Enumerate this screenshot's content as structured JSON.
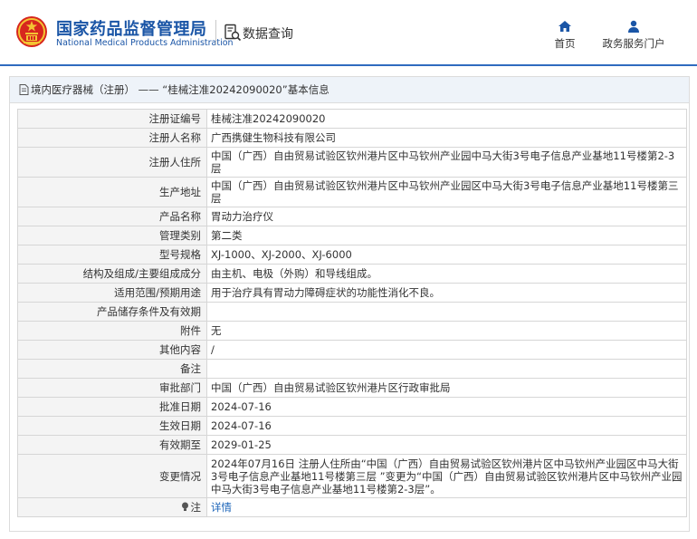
{
  "header": {
    "title_cn": "国家药品监督管理局",
    "title_en": "National Medical Products Administration",
    "query_label": "数据查询",
    "nav": [
      {
        "label": "首页",
        "icon": "home-icon"
      },
      {
        "label": "政务服务门户",
        "icon": "user-icon"
      }
    ]
  },
  "breadcrumb": {
    "text": "境内医疗器械（注册） —— “桂械注准20242090020”基本信息"
  },
  "rows": [
    {
      "label": "注册证编号",
      "value": "桂械注准20242090020"
    },
    {
      "label": "注册人名称",
      "value": "广西携健生物科技有限公司"
    },
    {
      "label": "注册人住所",
      "value": "中国（广西）自由贸易试验区钦州港片区中马钦州产业园中马大街3号电子信息产业基地11号楼第2-3层"
    },
    {
      "label": "生产地址",
      "value": "中国（广西）自由贸易试验区钦州港片区中马钦州产业园区中马大街3号电子信息产业基地11号楼第三层"
    },
    {
      "label": "产品名称",
      "value": "胃动力治疗仪"
    },
    {
      "label": "管理类别",
      "value": "第二类"
    },
    {
      "label": "型号规格",
      "value": "XJ-1000、XJ-2000、XJ-6000"
    },
    {
      "label": "结构及组成/主要组成成分",
      "value": "由主机、电极（外购）和导线组成。"
    },
    {
      "label": "适用范围/预期用途",
      "value": "用于治疗具有胃动力障碍症状的功能性消化不良。"
    },
    {
      "label": "产品储存条件及有效期",
      "value": ""
    },
    {
      "label": "附件",
      "value": "无"
    },
    {
      "label": "其他内容",
      "value": "/"
    },
    {
      "label": "备注",
      "value": ""
    },
    {
      "label": "审批部门",
      "value": "中国（广西）自由贸易试验区钦州港片区行政审批局"
    },
    {
      "label": "批准日期",
      "value": "2024-07-16"
    },
    {
      "label": "生效日期",
      "value": "2024-07-16"
    },
    {
      "label": "有效期至",
      "value": "2029-01-25"
    },
    {
      "label": "变更情况",
      "value": "2024年07月16日 注册人住所由“中国（广西）自由贸易试验区钦州港片区中马钦州产业园区中马大街3号电子信息产业基地11号楼第三层 ”变更为“中国（广西）自由贸易试验区钦州港片区中马钦州产业园中马大街3号电子信息产业基地11号楼第2-3层”。"
    }
  ],
  "note": {
    "label": "注",
    "link": "详情",
    "icon": "lightbulb-icon"
  },
  "colors": {
    "brand_blue": "#1a55a6",
    "link_blue": "#1a63b8",
    "header_line": "#2f6bbf",
    "emblem_red": "#d7261e",
    "emblem_gold": "#f3c433"
  }
}
